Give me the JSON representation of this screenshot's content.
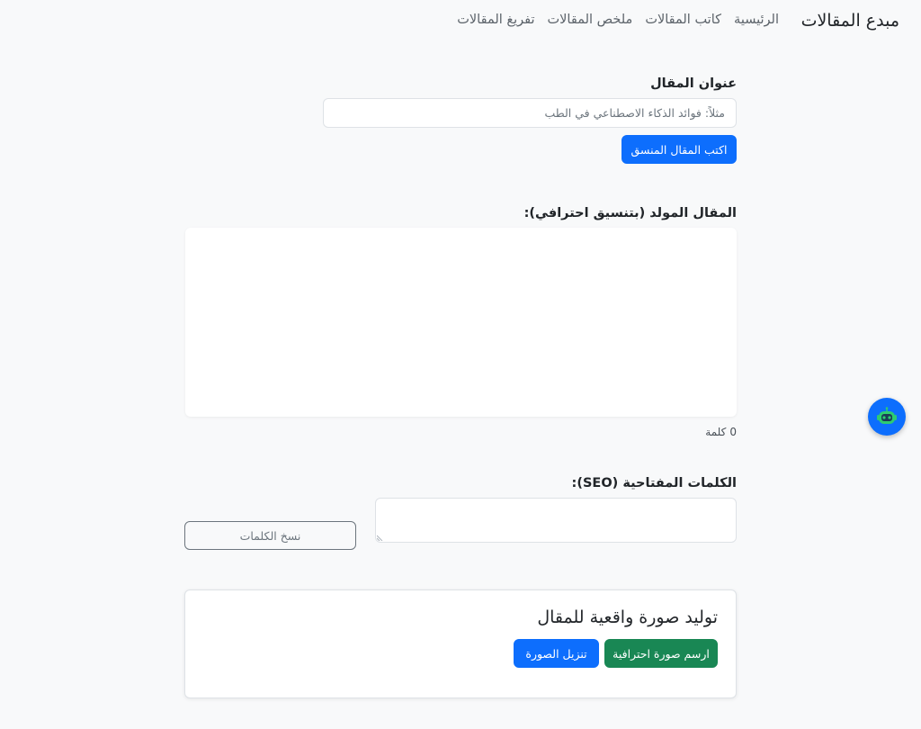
{
  "nav": {
    "brand": "مبدع المقالات",
    "links": [
      "الرئيسية",
      "كاتب المقالات",
      "ملخص المقالات",
      "تفريغ المقالات"
    ]
  },
  "form": {
    "title_label": "عنوان المقال",
    "title_placeholder": "مثلاً: فوائد الذكاء الاصطناعي في الطب",
    "title_value": "",
    "write_button": "اكتب المقال المنسق"
  },
  "output": {
    "label": "المقال المولد (بتنسيق احترافي):",
    "content": "",
    "word_count": "0",
    "word_unit": "كلمة"
  },
  "seo": {
    "label": "الكلمات المفتاحية (SEO):",
    "value": "",
    "copy_button": "نسخ الكلمات"
  },
  "image_card": {
    "title": "توليد صورة واقعية للمقال",
    "draw_button": "ارسم صورة احترافية",
    "download_button": "تنزيل الصورة"
  },
  "colors": {
    "primary": "#0d6efd",
    "success": "#198754",
    "robot_face": "#2ecc71"
  },
  "icons": {
    "assistant": "robot-icon",
    "resize": "resize-handle-icon"
  }
}
